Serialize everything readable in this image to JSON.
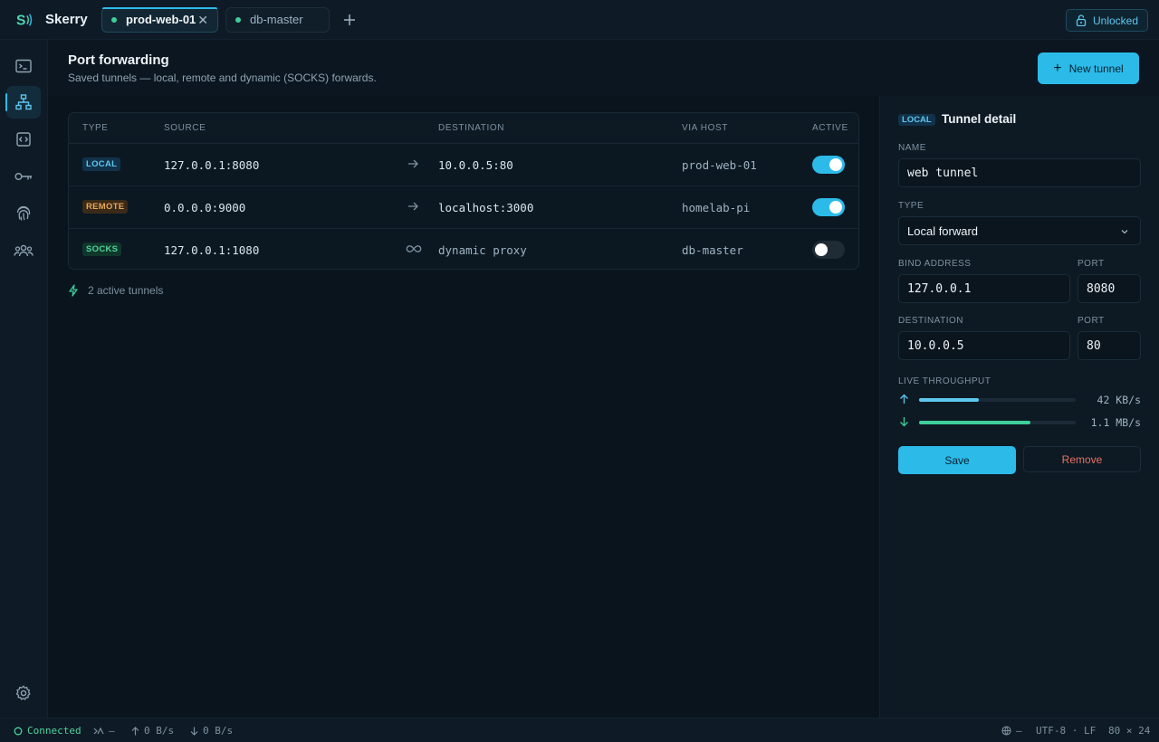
{
  "app": {
    "name": "Skerry"
  },
  "tabs": [
    {
      "label": "prod-web-01",
      "active": true
    },
    {
      "label": "db-master",
      "active": false
    }
  ],
  "lock_status": "Unlocked",
  "page": {
    "title": "Port forwarding",
    "subtitle": "Saved tunnels — local, remote and dynamic (SOCKS) forwards.",
    "new_button": "New tunnel"
  },
  "table": {
    "headers": [
      "TYPE",
      "SOURCE",
      "DESTINATION",
      "VIA HOST",
      "ACTIVE"
    ],
    "rows": [
      {
        "type": "LOCAL",
        "source": "127.0.0.1:8080",
        "destination": "10.0.0.5:80",
        "via": "prod-web-01",
        "active": true
      },
      {
        "type": "REMOTE",
        "source": "0.0.0.0:9000",
        "destination": "localhost:3000",
        "via": "homelab-pi",
        "active": true
      },
      {
        "type": "SOCKS",
        "source": "127.0.0.1:1080",
        "destination": "dynamic proxy",
        "via": "db-master",
        "active": false
      }
    ],
    "active_count": "2 active tunnels"
  },
  "detail": {
    "badge": "LOCAL",
    "title": "Tunnel detail",
    "name_label": "NAME",
    "name_value": "web tunnel",
    "type_label": "TYPE",
    "type_value": "Local forward",
    "bind_label": "BIND ADDRESS",
    "bind_value": "127.0.0.1",
    "bind_port_label": "PORT",
    "bind_port": "8080",
    "dest_label": "DESTINATION",
    "dest_value": "10.0.0.5",
    "dest_port_label": "PORT",
    "dest_port": "80",
    "throughput_label": "LIVE THROUGHPUT",
    "upload": {
      "value": "42 KB/s",
      "fraction": 0.38
    },
    "download": {
      "value": "1.1 MB/s",
      "fraction": 0.71
    },
    "save": "Save",
    "remove": "Remove"
  },
  "status": {
    "connection": "Connected",
    "transfer": "—",
    "up": "0 B/s",
    "down": "0 B/s",
    "globe": "—",
    "encoding": "UTF-8 · LF",
    "size": "80 × 24"
  },
  "colors": {
    "accent": "#2cbbe9",
    "success": "#3ecf9a",
    "warning": "#e8a65a",
    "danger": "#e57362"
  }
}
